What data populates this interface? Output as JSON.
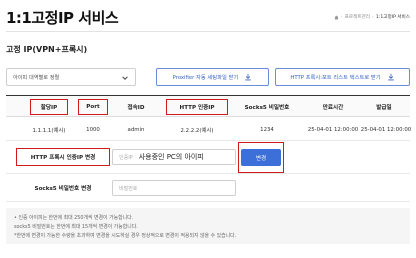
{
  "header": {
    "title": "1:1고정IP 서비스",
    "breadcrumb": [
      "프로젝트관리",
      "1:1고정IP 서비스"
    ]
  },
  "section": {
    "title": "고정 IP(VPN+프록시)"
  },
  "toolbar": {
    "sort_value": "아이피 대역별로 정렬",
    "proxifier_button": "Proxifier 자동 세팅파일 받기",
    "http_proxy_button": "HTTP 프록시:포트 리스트 텍스트로 받기"
  },
  "table": {
    "headers": [
      "할당IP",
      "Port",
      "접속ID",
      "HTTP 인증IP",
      "Socks5 비밀번호",
      "만료시간",
      "발급일"
    ],
    "rows": [
      [
        "1.1.1.1(예시)",
        "1000",
        "admin",
        "2.2.2.2(예시)",
        "1234",
        "25-04-01 12:00:00",
        "25-04-01 12:00:00"
      ]
    ]
  },
  "http_auth_form": {
    "label": "HTTP 프록시 인증IP 변경",
    "placeholder": "인증IP",
    "value": "사용중인 PC의 아이피",
    "button": "변경"
  },
  "socks_form": {
    "label": "Socks5 비밀번호 변경",
    "placeholder": "비밀번호"
  },
  "notes": [
    "• 인증 아이피는 한번에 최대 250개씩 변경이 가능합니다.",
    "  socks5 비밀번호는 한번에 최대 15개씩 변경이 가능합니다.",
    "  *한번에 변경이 가능한 수량을 초과하여 변경을 시도하실 경우 정상적으로 변경이 적용되지 않을 수 있습니다."
  ],
  "colors": {
    "accent": "#3d6fd8",
    "highlight": "#d11a1a"
  }
}
